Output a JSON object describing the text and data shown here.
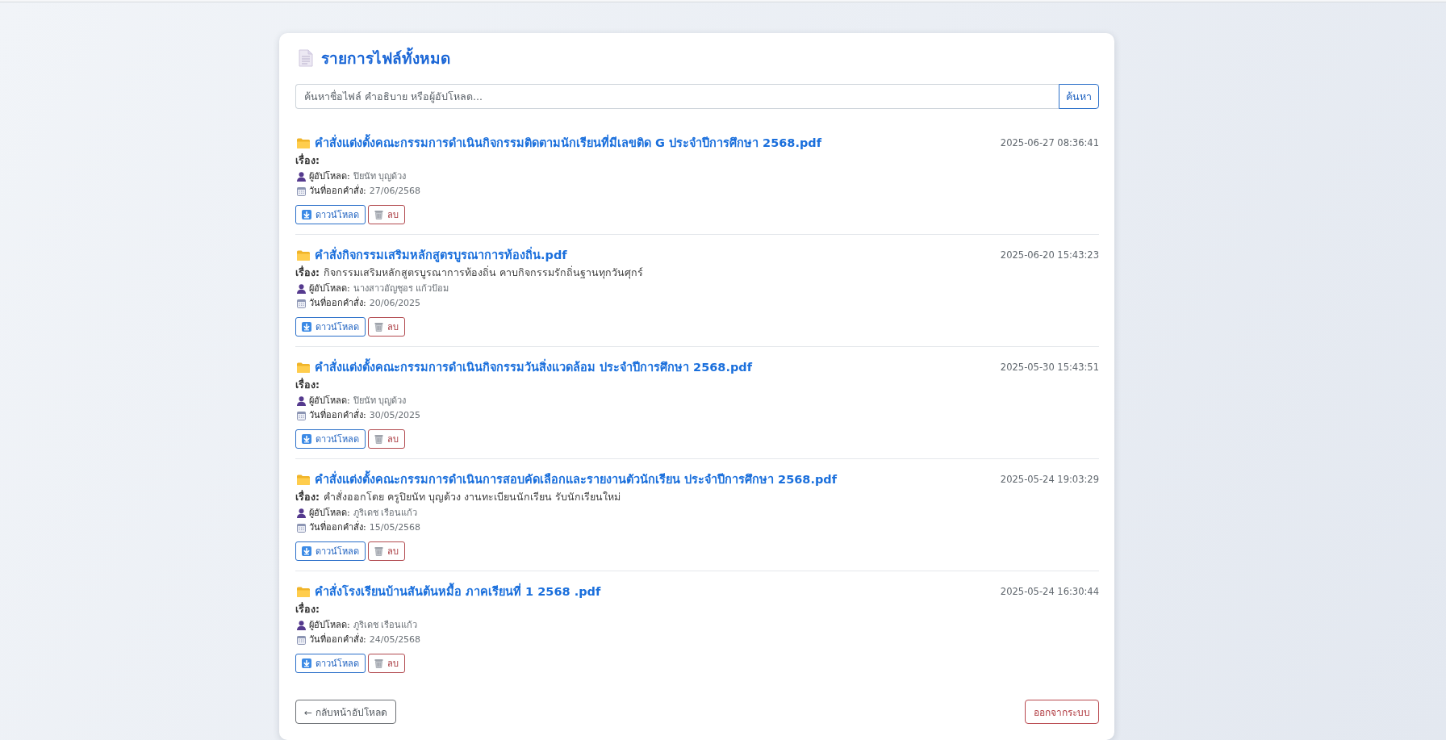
{
  "page": {
    "title": "รายการไฟล์ทั้งหมด"
  },
  "search": {
    "placeholder": "ค้นหาชื่อไฟล์ คำอธิบาย หรือผู้อัปโหลด...",
    "button": "ค้นหา"
  },
  "files": [
    {
      "name": "คำสั่งแต่งตั้งคณะกรรมการดำเนินกิจกรรมติดตามนักเรียนที่มีเลขติด G ประจำปีการศึกษา 2568.pdf",
      "timestamp": "2025-06-27 08:36:41",
      "subject_label": "เรื่อง:",
      "uploader_label": "ผู้อัปโหลด:",
      "uploader": "ปิยนัท บุญด้วง",
      "date_label": "วันที่ออกคำสั่ง:",
      "date": "27/06/2568",
      "download_label": "ดาวน์โหลด",
      "delete_label": "ลบ"
    },
    {
      "name": "คำสั่งกิจกรรมเสริมหลักสูตรบูรณาการท้องถิ่น.pdf",
      "timestamp": "2025-06-20 15:43:23",
      "subject_label": "เรื่อง:",
      "subject": "กิจกรรมเสริมหลักสูตรบูรณาการท้องถิ่น คาบกิจกรรมรักถิ่นฐานทุกวันศุกร์",
      "uploader_label": "ผู้อัปโหลด:",
      "uploader": "นางสาวอัญชุอร แก้วป้อม",
      "date_label": "วันที่ออกคำสั่ง:",
      "date": "20/06/2025",
      "download_label": "ดาวน์โหลด",
      "delete_label": "ลบ"
    },
    {
      "name": "คำสั่งแต่งตั้งคณะกรรมการดำเนินกิจกรรมวันสิ่งแวดล้อม ประจำปีการศึกษา 2568.pdf",
      "timestamp": "2025-05-30 15:43:51",
      "subject_label": "เรื่อง:",
      "uploader_label": "ผู้อัปโหลด:",
      "uploader": "ปิยนัท บุญด้วง",
      "date_label": "วันที่ออกคำสั่ง:",
      "date": "30/05/2025",
      "download_label": "ดาวน์โหลด",
      "delete_label": "ลบ"
    },
    {
      "name": "คำสั่งแต่งตั้งคณะกรรมการดำเนินการสอบคัดเลือกและรายงานตัวนักเรียน ประจำปีการศึกษา 2568.pdf",
      "timestamp": "2025-05-24 19:03:29",
      "subject_label": "เรื่อง:",
      "subject": "คำสั่งออกโดย ครูปิยนัท บุญด้วง งานทะเบียนนักเรียน รับนักเรียนใหม่",
      "uploader_label": "ผู้อัปโหลด:",
      "uploader": "ภูริเดช เรือนแก้ว",
      "date_label": "วันที่ออกคำสั่ง:",
      "date": "15/05/2568",
      "download_label": "ดาวน์โหลด",
      "delete_label": "ลบ"
    },
    {
      "name": "คำสั่งโรงเรียนบ้านสันต้นหมื้อ ภาคเรียนที่ 1 2568 .pdf",
      "timestamp": "2025-05-24 16:30:44",
      "subject_label": "เรื่อง:",
      "uploader_label": "ผู้อัปโหลด:",
      "uploader": "ภูริเดช เรือนแก้ว",
      "date_label": "วันที่ออกคำสั่ง:",
      "date": "24/05/2568",
      "download_label": "ดาวน์โหลด",
      "delete_label": "ลบ"
    }
  ],
  "footer": {
    "back_button": "← กลับหน้าอัปโหลด",
    "logout_button": "ออกจากระบบ"
  }
}
